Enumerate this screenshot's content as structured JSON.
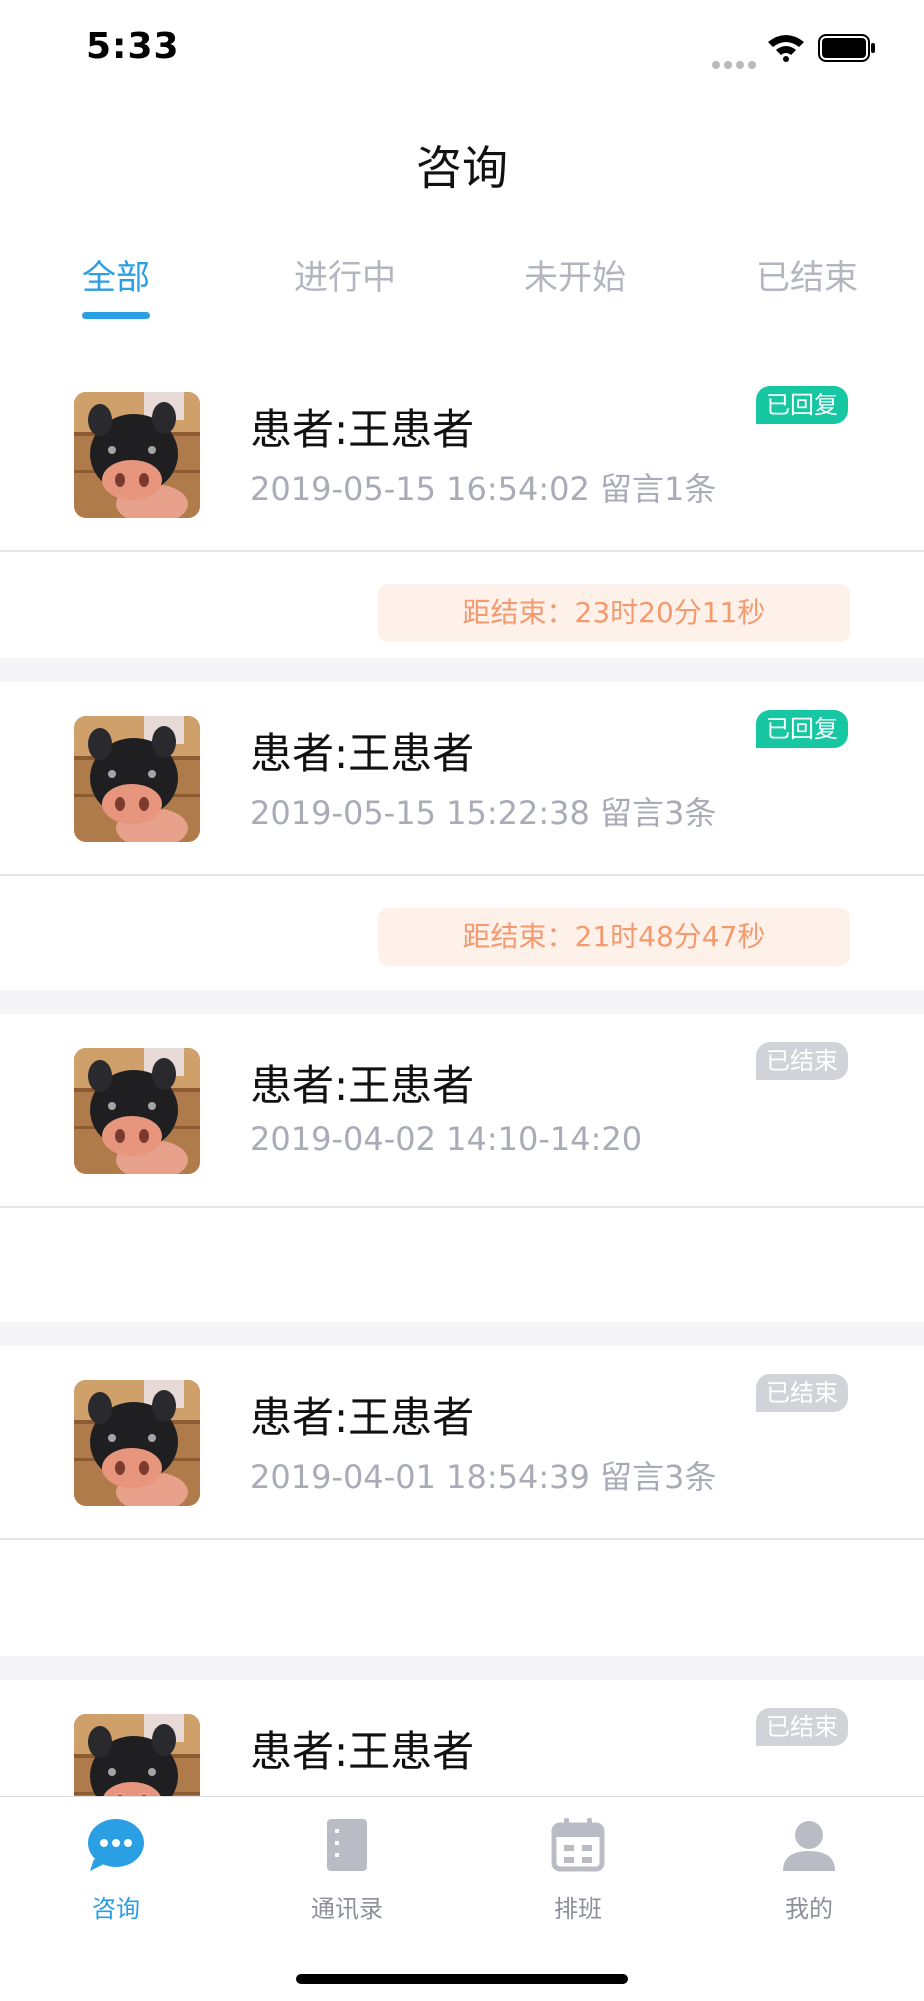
{
  "status_bar": {
    "time": "5:33"
  },
  "header": {
    "title": "咨询"
  },
  "tabs": [
    {
      "label": "全部",
      "active": true
    },
    {
      "label": "进行中"
    },
    {
      "label": "未开始"
    },
    {
      "label": "已结束"
    }
  ],
  "consultations": [
    {
      "patient": "患者:王患者",
      "meta": "2019-05-15 16:54:02 留言1条",
      "status": "已回复",
      "countdown": "距结束：23时20分11秒"
    },
    {
      "patient": "患者:王患者",
      "meta": "2019-05-15 15:22:38 留言3条",
      "status": "已回复",
      "countdown": "距结束：21时48分47秒"
    },
    {
      "patient": "患者:王患者",
      "meta": "2019-04-02 14:10-14:20",
      "status": "已结束"
    },
    {
      "patient": "患者:王患者",
      "meta": "2019-04-01 18:54:39 留言3条",
      "status": "已结束"
    },
    {
      "patient": "患者:王患者",
      "status": "已结束"
    }
  ],
  "tabbar": [
    {
      "label": "咨询",
      "icon": "chat-bubble-icon",
      "active": true
    },
    {
      "label": "通讯录",
      "icon": "contacts-book-icon"
    },
    {
      "label": "排班",
      "icon": "calendar-icon"
    },
    {
      "label": "我的",
      "icon": "person-icon"
    }
  ],
  "colors": {
    "accent": "#2b9fe3",
    "replied_badge": "#16c7a1",
    "ended_badge": "#d2d3d8",
    "countdown_text": "#f39a6e",
    "countdown_bg": "#fef1ea"
  }
}
